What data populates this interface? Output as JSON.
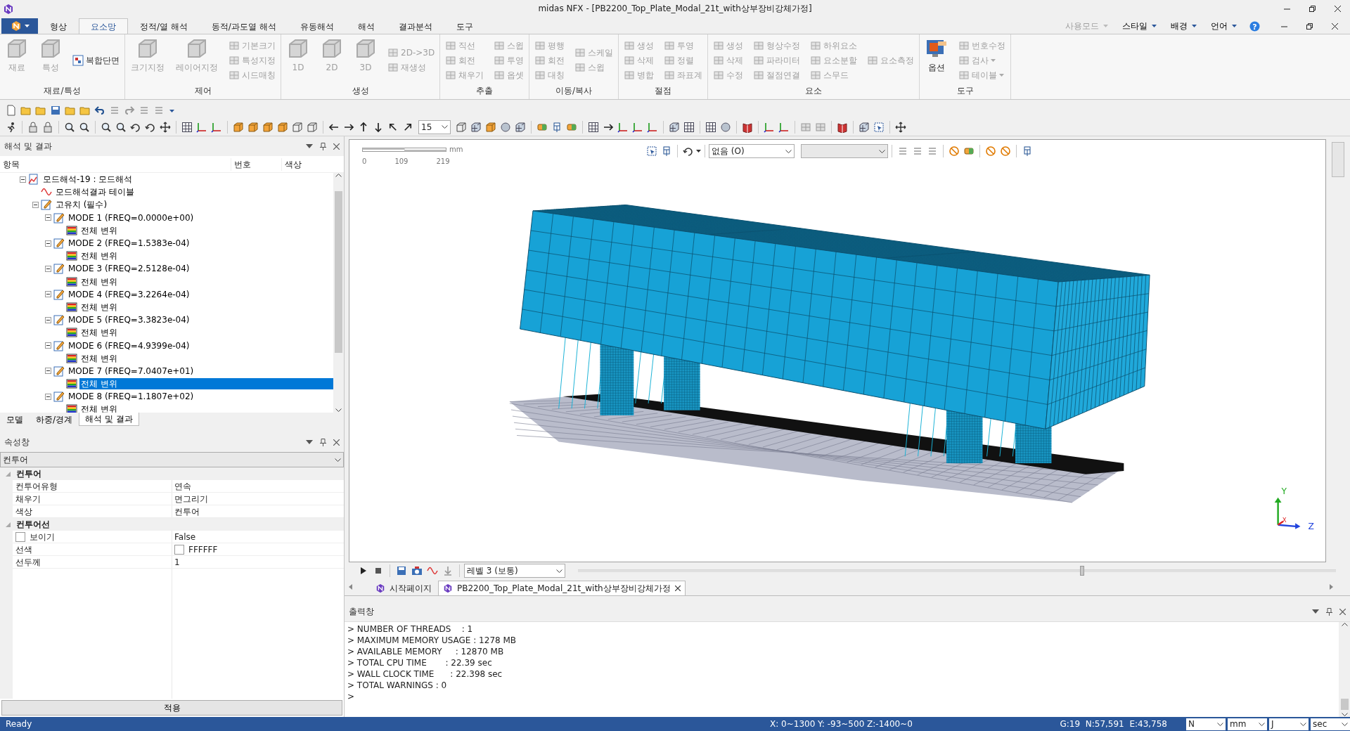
{
  "window": {
    "title": "midas NFX - [PB2200_Top_Plate_Modal_21t_with상부장비강체가정]"
  },
  "ribbon": {
    "tabs": [
      {
        "label": "형상",
        "selected": false
      },
      {
        "label": "요소망",
        "selected": true
      },
      {
        "label": "정적/열 해석",
        "selected": false
      },
      {
        "label": "동적/과도열 해석",
        "selected": false
      },
      {
        "label": "유동해석",
        "selected": false
      },
      {
        "label": "해석",
        "selected": false
      },
      {
        "label": "결과분석",
        "selected": false
      },
      {
        "label": "도구",
        "selected": false
      }
    ],
    "right_menu": [
      {
        "label": "사용모드",
        "disabled": true
      },
      {
        "label": "스타일",
        "disabled": false
      },
      {
        "label": "배경",
        "disabled": false
      },
      {
        "label": "언어",
        "disabled": false
      }
    ],
    "help": "?",
    "groups": [
      {
        "label": "재료/특성",
        "items": [
          {
            "label": "재료",
            "kind": "large",
            "disabled": true
          },
          {
            "label": "특성",
            "kind": "large",
            "disabled": true
          },
          {
            "label": "복합단면",
            "kind": "small",
            "disabled": false
          }
        ]
      },
      {
        "label": "제어",
        "items": [
          {
            "label": "크기지정",
            "kind": "large",
            "disabled": true
          },
          {
            "label": "레이어지정",
            "kind": "large",
            "disabled": true
          },
          {
            "label": "기본크기",
            "kind": "small",
            "disabled": true
          },
          {
            "label": "특성지정",
            "kind": "small",
            "disabled": true
          },
          {
            "label": "시드매칭",
            "kind": "small",
            "disabled": true
          }
        ]
      },
      {
        "label": "생성",
        "items": [
          {
            "label": "1D",
            "kind": "large",
            "disabled": true
          },
          {
            "label": "2D",
            "kind": "large",
            "disabled": true
          },
          {
            "label": "3D",
            "kind": "large",
            "disabled": true
          },
          {
            "label": "2D->3D",
            "kind": "small",
            "disabled": true
          },
          {
            "label": "재생성",
            "kind": "small",
            "disabled": true
          }
        ]
      },
      {
        "label": "추출",
        "items": [
          {
            "label": "직선",
            "kind": "small",
            "disabled": true
          },
          {
            "label": "회전",
            "kind": "small",
            "disabled": true
          },
          {
            "label": "채우기",
            "kind": "small",
            "disabled": true
          },
          {
            "label": "스윕",
            "kind": "small",
            "disabled": true
          },
          {
            "label": "투영",
            "kind": "small",
            "disabled": true
          },
          {
            "label": "옵셋",
            "kind": "small",
            "disabled": true
          }
        ]
      },
      {
        "label": "이동/복사",
        "items": [
          {
            "label": "평행",
            "kind": "small",
            "disabled": true
          },
          {
            "label": "회전",
            "kind": "small",
            "disabled": true
          },
          {
            "label": "대칭",
            "kind": "small",
            "disabled": true
          },
          {
            "label": "스케일",
            "kind": "small",
            "disabled": true
          },
          {
            "label": "스윕",
            "kind": "small",
            "disabled": true
          }
        ]
      },
      {
        "label": "절점",
        "items": [
          {
            "label": "생성",
            "kind": "small",
            "disabled": true
          },
          {
            "label": "삭제",
            "kind": "small",
            "disabled": true
          },
          {
            "label": "병합",
            "kind": "small",
            "disabled": true
          },
          {
            "label": "투영",
            "kind": "small",
            "disabled": true
          },
          {
            "label": "정렬",
            "kind": "small",
            "disabled": true
          },
          {
            "label": "좌표계",
            "kind": "small",
            "disabled": true
          }
        ]
      },
      {
        "label": "요소",
        "items": [
          {
            "label": "생성",
            "kind": "small",
            "disabled": true
          },
          {
            "label": "삭제",
            "kind": "small",
            "disabled": true
          },
          {
            "label": "수정",
            "kind": "small",
            "disabled": true
          },
          {
            "label": "형상수정",
            "kind": "small",
            "disabled": true
          },
          {
            "label": "파라미터",
            "kind": "small",
            "disabled": true
          },
          {
            "label": "절점연결",
            "kind": "small",
            "disabled": true
          },
          {
            "label": "하위요소",
            "kind": "small",
            "disabled": true
          },
          {
            "label": "요소분할",
            "kind": "small",
            "disabled": true
          },
          {
            "label": "스무드",
            "kind": "small",
            "disabled": true
          },
          {
            "label": "요소측정",
            "kind": "small",
            "disabled": true
          }
        ]
      },
      {
        "label": "도구",
        "items": [
          {
            "label": "옵션",
            "kind": "large",
            "disabled": false
          },
          {
            "label": "번호수정",
            "kind": "small",
            "disabled": true
          },
          {
            "label": "검사",
            "kind": "small",
            "disabled": true,
            "dropdown": true
          },
          {
            "label": "테이블",
            "kind": "small",
            "disabled": true,
            "dropdown": true
          }
        ]
      }
    ]
  },
  "main_toolbar": {
    "zoom_value": "15"
  },
  "tree_panel": {
    "title": "해석 및 결과",
    "columns": [
      "항목",
      "번호",
      "색상"
    ],
    "items": [
      {
        "label": "모드해석-19 : 모드해석",
        "kind": "analysis",
        "expanded": true,
        "selected": false,
        "children": [
          {
            "label": "모드해석결과 테이블",
            "kind": "table",
            "selected": false
          },
          {
            "label": "고유치 (필수)",
            "kind": "set",
            "expanded": true,
            "selected": false,
            "children": [
              {
                "label": "MODE 1 (FREQ=0.0000e+00)",
                "kind": "mode",
                "expanded": true,
                "selected": false,
                "children": [
                  {
                    "label": "전체 변위",
                    "kind": "result",
                    "selected": false
                  }
                ]
              },
              {
                "label": "MODE 2 (FREQ=1.5383e-04)",
                "kind": "mode",
                "expanded": true,
                "selected": false,
                "children": [
                  {
                    "label": "전체 변위",
                    "kind": "result",
                    "selected": false
                  }
                ]
              },
              {
                "label": "MODE 3 (FREQ=2.5128e-04)",
                "kind": "mode",
                "expanded": true,
                "selected": false,
                "children": [
                  {
                    "label": "전체 변위",
                    "kind": "result",
                    "selected": false
                  }
                ]
              },
              {
                "label": "MODE 4 (FREQ=3.2264e-04)",
                "kind": "mode",
                "expanded": true,
                "selected": false,
                "children": [
                  {
                    "label": "전체 변위",
                    "kind": "result",
                    "selected": false
                  }
                ]
              },
              {
                "label": "MODE 5 (FREQ=3.3823e-04)",
                "kind": "mode",
                "expanded": true,
                "selected": false,
                "children": [
                  {
                    "label": "전체 변위",
                    "kind": "result",
                    "selected": false
                  }
                ]
              },
              {
                "label": "MODE 6 (FREQ=4.9399e-04)",
                "kind": "mode",
                "expanded": true,
                "selected": false,
                "children": [
                  {
                    "label": "전체 변위",
                    "kind": "result",
                    "selected": false
                  }
                ]
              },
              {
                "label": "MODE 7 (FREQ=7.0407e+01)",
                "kind": "mode",
                "expanded": true,
                "selected": false,
                "children": [
                  {
                    "label": "전체 변위",
                    "kind": "result",
                    "selected": true
                  }
                ]
              },
              {
                "label": "MODE 8 (FREQ=1.1807e+02)",
                "kind": "mode",
                "expanded": true,
                "selected": false,
                "children": [
                  {
                    "label": "전체 변위",
                    "kind": "result",
                    "selected": false
                  }
                ]
              }
            ]
          }
        ]
      }
    ],
    "tabs": [
      {
        "label": "모델",
        "selected": false
      },
      {
        "label": "하중/경계",
        "selected": false
      },
      {
        "label": "해석 및 결과",
        "selected": true
      }
    ]
  },
  "properties": {
    "title": "속성창",
    "category": "컨투어",
    "groups": [
      {
        "label": "컨투어",
        "expanded": true,
        "rows": [
          {
            "name": "컨투어유형",
            "value": "연속",
            "kind": "text"
          },
          {
            "name": "채우기",
            "value": "면그리기",
            "kind": "text"
          },
          {
            "name": "색상",
            "value": "컨투어",
            "kind": "text"
          }
        ]
      },
      {
        "label": "컨투어선",
        "expanded": true,
        "rows": [
          {
            "name": "보이기",
            "value": "False",
            "kind": "checkbox",
            "checked": false
          },
          {
            "name": "선색",
            "value": "FFFFFF",
            "kind": "color",
            "color": "#ffffff"
          },
          {
            "name": "선두께",
            "value": "1",
            "kind": "text"
          }
        ]
      }
    ],
    "apply": "적용"
  },
  "viewport": {
    "scale": {
      "unit": "mm",
      "ticks": [
        "0",
        "109",
        "219"
      ]
    },
    "display_combo": "없음 (O)",
    "axes": [
      "Y",
      "Z",
      "X"
    ]
  },
  "animation": {
    "level_combo": "레벨 3 (보통)",
    "level": 0.665
  },
  "documents": [
    {
      "label": "시작페이지",
      "selected": false
    },
    {
      "label": "PB2200_Top_Plate_Modal_21t_with상부장비강체가정",
      "selected": true
    }
  ],
  "output": {
    "title": "출력창",
    "lines": [
      "> NUMBER OF THREADS    : 1",
      "> MAXIMUM MEMORY USAGE : 1278 MB",
      "> AVAILABLE MEMORY     : 12870 MB",
      "> TOTAL CPU TIME       : 22.39 sec",
      "> WALL CLOCK TIME      : 22.398 sec",
      "> TOTAL WARNINGS : 0",
      ">"
    ]
  },
  "status_bar": {
    "message": "Ready",
    "range": "X: 0~1300 Y: -93~500 Z:-1400~0",
    "counts": "G:19  N:57,591  E:43,758",
    "units": [
      "N",
      "mm",
      "J",
      "sec"
    ]
  }
}
